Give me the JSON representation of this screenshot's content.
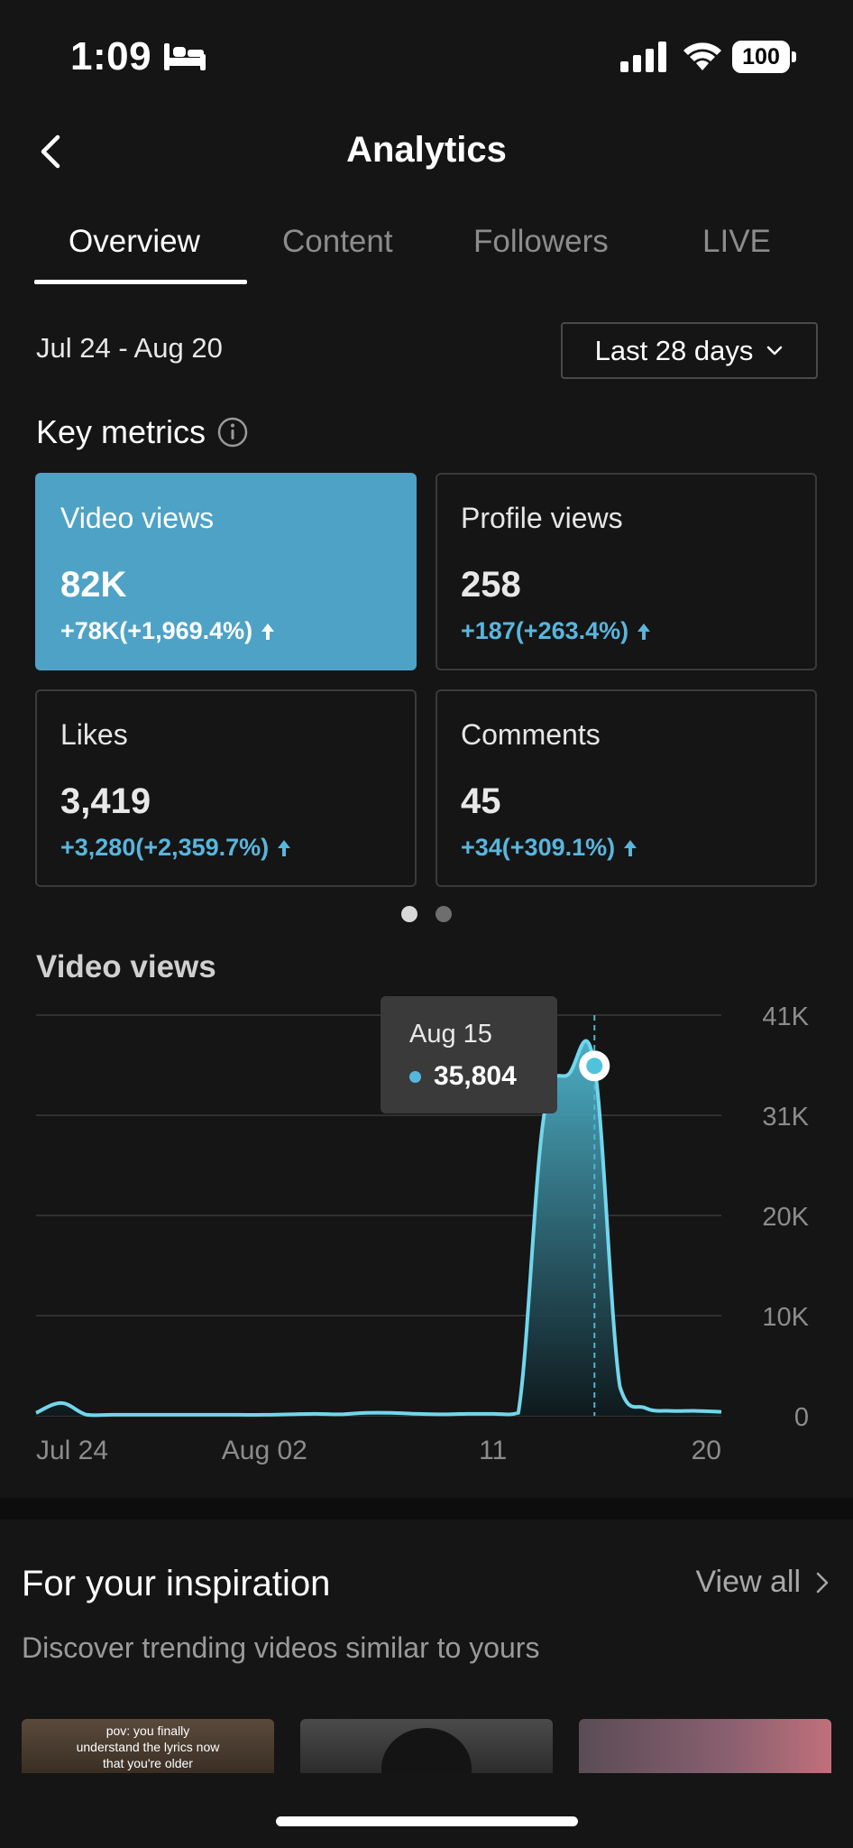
{
  "status_bar": {
    "time": "1:09",
    "battery": "100",
    "icons": [
      "bed-icon",
      "signal-icon",
      "wifi-icon",
      "battery-icon"
    ]
  },
  "header": {
    "title": "Analytics",
    "back_icon": "chevron-left-icon"
  },
  "tabs": [
    {
      "label": "Overview",
      "active": true
    },
    {
      "label": "Content",
      "active": false
    },
    {
      "label": "Followers",
      "active": false
    },
    {
      "label": "LIVE",
      "active": false
    }
  ],
  "date_range": "Jul 24 - Aug 20",
  "period_select": {
    "value": "Last 28 days"
  },
  "key_metrics": {
    "title": "Key metrics",
    "cards": [
      {
        "label": "Video views",
        "value": "82K",
        "change": "+78K(+1,969.4%)",
        "selected": true
      },
      {
        "label": "Profile views",
        "value": "258",
        "change": "+187(+263.4%)",
        "selected": false
      },
      {
        "label": "Likes",
        "value": "3,419",
        "change": "+3,280(+2,359.7%)",
        "selected": false
      },
      {
        "label": "Comments",
        "value": "45",
        "change": "+34(+309.1%)",
        "selected": false
      }
    ],
    "pages": 2,
    "current_page": 1
  },
  "chart_data": {
    "type": "area",
    "title": "Video views",
    "x": [
      "Jul 24",
      "Jul 25",
      "Jul 26",
      "Jul 27",
      "Jul 28",
      "Jul 29",
      "Jul 30",
      "Jul 31",
      "Aug 01",
      "Aug 02",
      "Aug 03",
      "Aug 04",
      "Aug 05",
      "Aug 06",
      "Aug 07",
      "Aug 08",
      "Aug 09",
      "Aug 10",
      "Aug 11",
      "Aug 12",
      "Aug 13",
      "Aug 14",
      "Aug 15",
      "Aug 16",
      "Aug 17",
      "Aug 18",
      "Aug 19",
      "Aug 20"
    ],
    "values": [
      300,
      1300,
      100,
      100,
      100,
      100,
      100,
      100,
      100,
      100,
      150,
      200,
      150,
      300,
      300,
      200,
      150,
      200,
      200,
      300,
      30500,
      35000,
      35804,
      3000,
      800,
      500,
      500,
      400
    ],
    "x_tick_labels": [
      "Jul 24",
      "Aug 02",
      "11",
      "20"
    ],
    "y_tick_labels": [
      "0",
      "10K",
      "20K",
      "31K",
      "41K"
    ],
    "ylim": [
      0,
      41000
    ],
    "grid": true,
    "series_color": "#72d6ec",
    "tooltip": {
      "date": "Aug 15",
      "value": "35,804",
      "index": 22
    }
  },
  "inspiration": {
    "title": "For your inspiration",
    "view_all": "View all",
    "subtitle": "Discover trending videos similar to yours",
    "thumbnails": [
      {
        "caption": "pov: you finally\nunderstand the lyrics now\nthat you're older"
      },
      {
        "caption": ""
      },
      {
        "caption": ""
      }
    ]
  },
  "colors": {
    "accent": "#4ea2c6",
    "positive": "#58b6dd",
    "background": "#151515"
  }
}
